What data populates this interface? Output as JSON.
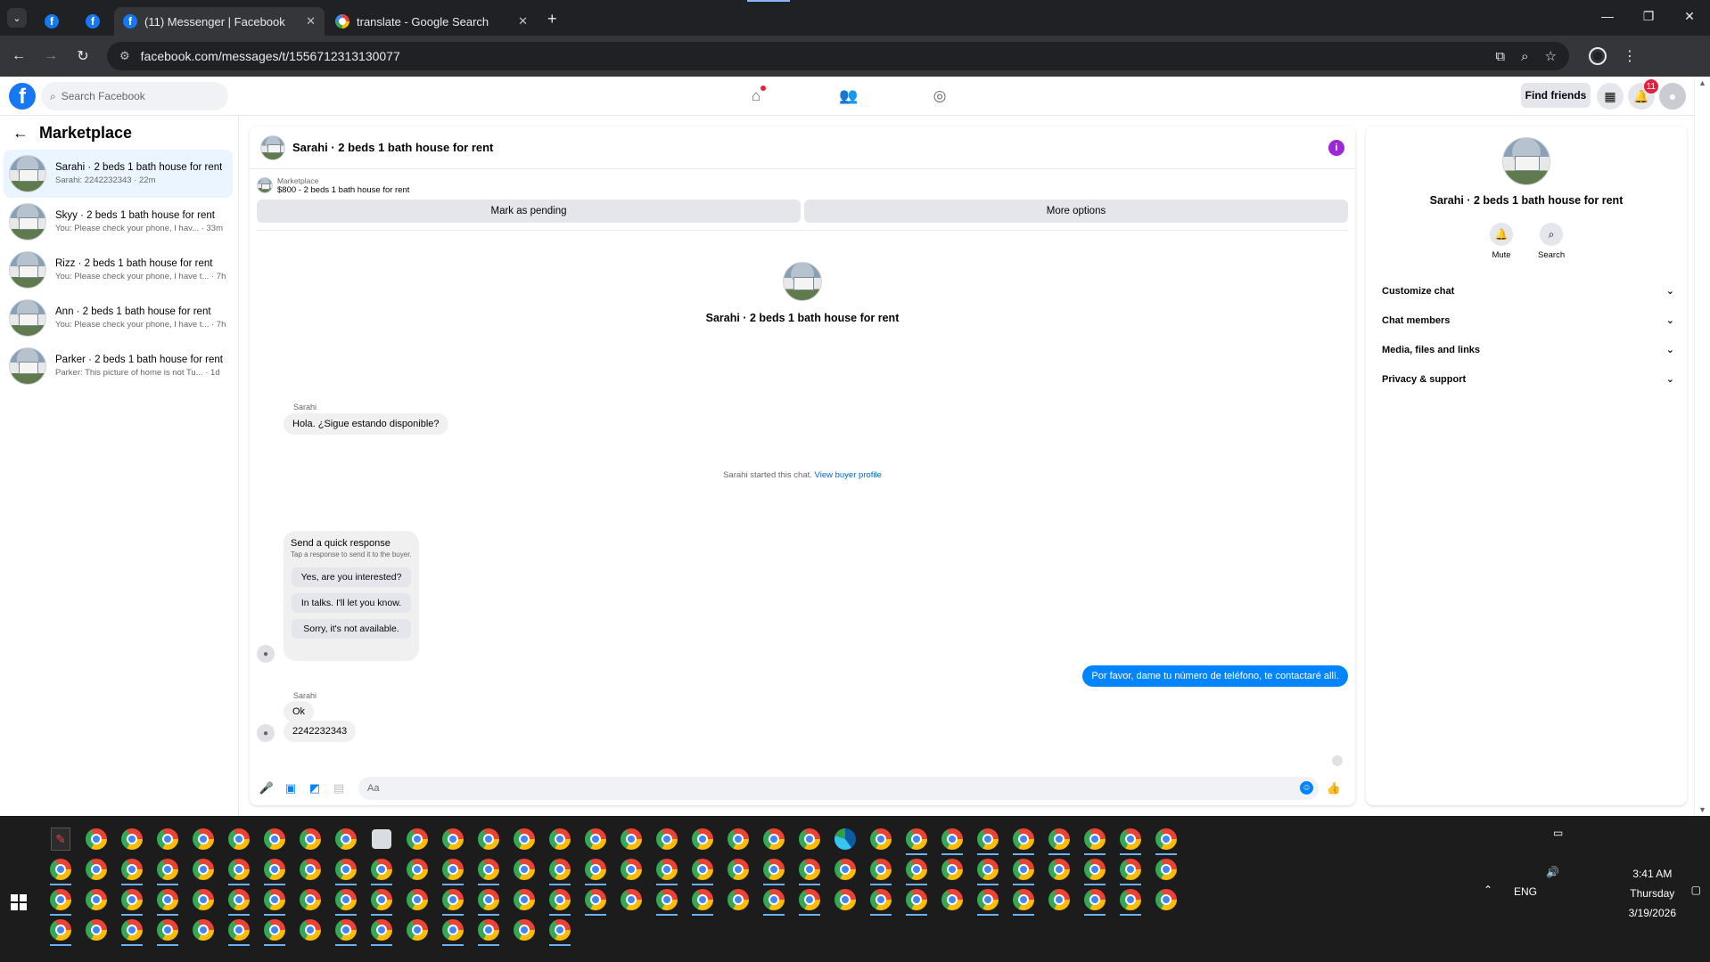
{
  "browser": {
    "tabs": [
      {
        "title": "",
        "pinned": true
      },
      {
        "title": "",
        "pinned": true
      },
      {
        "title": "(11) Messenger | Facebook",
        "active": true
      },
      {
        "title": "translate - Google Search"
      }
    ],
    "tab_close": "✕",
    "new_tab": "+",
    "url": "facebook.com/messages/t/1556712313130077",
    "window_controls": {
      "minimize": "—",
      "restore": "❐",
      "close": "✕"
    }
  },
  "fb": {
    "search_placeholder": "Search Facebook",
    "find_friends": "Find friends",
    "notification_count": "11",
    "logo_letter": "f"
  },
  "left_panel": {
    "title": "Marketplace",
    "conversations": [
      {
        "name": "Sarahi · 2 beds 1 bath house for rent",
        "preview": "Sarahi: 2242232343 · 22m",
        "active": true
      },
      {
        "name": "Skyy · 2 beds 1 bath house for rent",
        "preview": "You: Please check your phone, I hav... · 33m"
      },
      {
        "name": "Rizz · 2 beds 1 bath house for rent",
        "preview": "You: Please check your phone, I have t... · 7h"
      },
      {
        "name": "Ann · 2 beds 1 bath house for rent",
        "preview": "You: Please check your phone, I have t... · 7h"
      },
      {
        "name": "Parker · 2 beds 1 bath house for rent",
        "preview": "Parker: This picture of home is not Tu... · 1d"
      }
    ]
  },
  "chat": {
    "title": "Sarahi · 2 beds 1 bath house for rent",
    "listing_label": "Marketplace",
    "listing_title": "$800 - 2 beds 1 bath house for rent",
    "mark_pending": "Mark as pending",
    "more_options": "More options",
    "center_title": "Sarahi · 2 beds 1 bath house for rent",
    "started_text": "Sarahi started this chat.",
    "view_buyer_profile": "View buyer profile",
    "sender_name": "Sarahi",
    "messages": {
      "m1": "Hola. ¿Sigue estando disponible?",
      "m_me": "Por favor, dame tu número de teléfono, te contactaré allí.",
      "m3": "Ok",
      "m4": "2242232343"
    },
    "quick_response": {
      "title": "Send a quick response",
      "subtitle": "Tap a response to send it to the buyer.",
      "options": [
        "Yes, are you interested?",
        "In talks. I'll let you know.",
        "Sorry, it's not available."
      ]
    },
    "composer_placeholder": "Aa"
  },
  "right_panel": {
    "title": "Sarahi · 2 beds 1 bath house for rent",
    "mute": "Mute",
    "search": "Search",
    "menu": [
      "Customize chat",
      "Chat members",
      "Media, files and links",
      "Privacy & support"
    ]
  },
  "taskbar": {
    "language": "ENG",
    "time": "3:41 AM",
    "day": "Thursday",
    "date": "3/19/2026"
  }
}
